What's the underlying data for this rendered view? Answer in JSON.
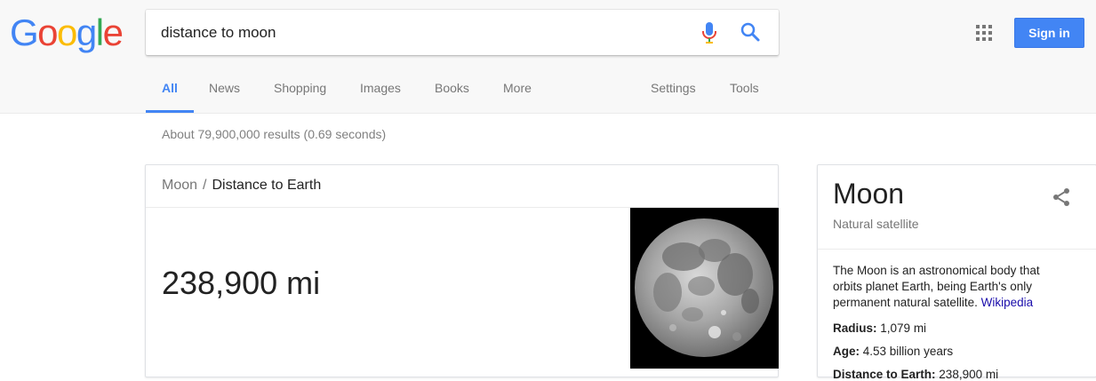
{
  "logo": {
    "letters": [
      "G",
      "o",
      "o",
      "g",
      "l",
      "e"
    ],
    "colors": [
      "#4285f4",
      "#ea4335",
      "#fbbc05",
      "#4285f4",
      "#34a853",
      "#ea4335"
    ]
  },
  "search": {
    "query": "distance to moon"
  },
  "header": {
    "sign_in_label": "Sign in",
    "accent_color": "#4285f4"
  },
  "tabs": [
    {
      "label": "All",
      "active": true
    },
    {
      "label": "News",
      "active": false
    },
    {
      "label": "Shopping",
      "active": false
    },
    {
      "label": "Images",
      "active": false
    },
    {
      "label": "Books",
      "active": false
    },
    {
      "label": "More",
      "active": false
    }
  ],
  "tools": [
    {
      "label": "Settings"
    },
    {
      "label": "Tools"
    }
  ],
  "results": {
    "stats": "About 79,900,000 results (0.69 seconds)"
  },
  "answer": {
    "breadcrumb_parent": "Moon",
    "breadcrumb_separator": "/",
    "breadcrumb_current": "Distance to Earth",
    "value": "238,900 mi"
  },
  "knowledge_panel": {
    "title": "Moon",
    "subtitle": "Natural satellite",
    "description": "The Moon is an astronomical body that orbits planet Earth, being Earth's only permanent natural satellite.",
    "source_link": "Wikipedia",
    "facts": [
      {
        "label": "Radius:",
        "value": "1,079 mi"
      },
      {
        "label": "Age:",
        "value": "4.53 billion years"
      },
      {
        "label": "Distance to Earth:",
        "value": "238,900 mi"
      }
    ],
    "link_color": "#1a0dab"
  }
}
